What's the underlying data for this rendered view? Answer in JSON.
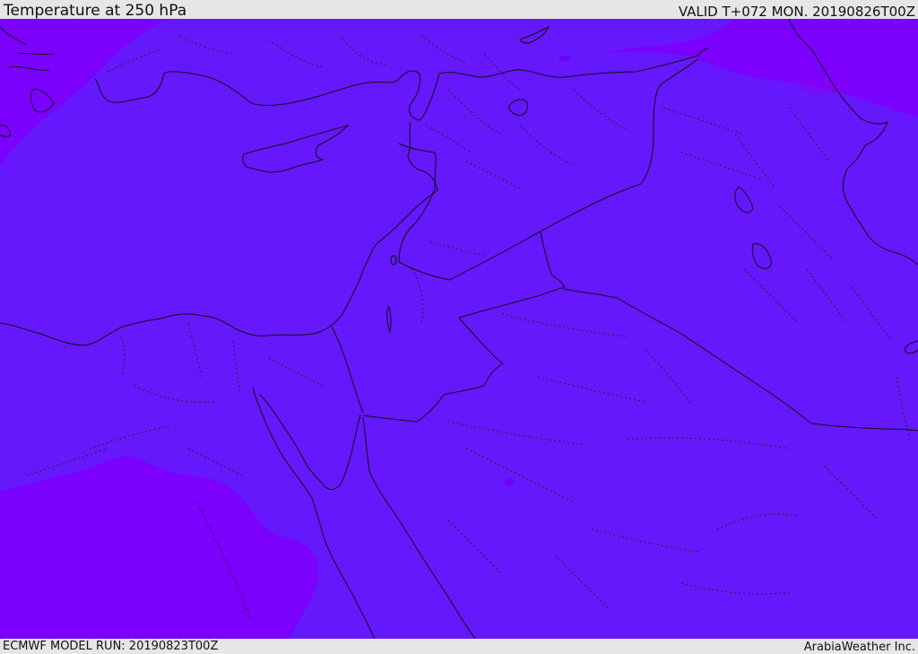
{
  "header": {
    "title": "Temperature at 250 hPa",
    "valid_time": "VALID T+072 MON. 20190826T00Z"
  },
  "footer": {
    "model_run": "ECMWF MODEL RUN: 20190823T00Z",
    "credit": "ArabiaWeather Inc."
  },
  "colors": {
    "field_main": "#6418fb",
    "field_cold": "#7b00fe",
    "field_coldest": "#8800f8",
    "coastline": "#111111",
    "frame_bg": "#e6e6e6"
  }
}
